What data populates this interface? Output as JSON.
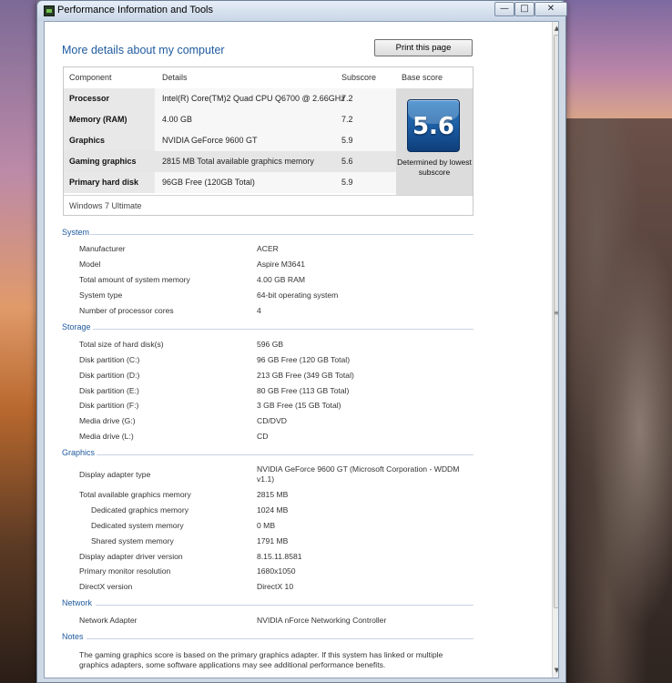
{
  "window": {
    "title": "Performance Information and Tools",
    "controls": {
      "minimize": "—",
      "maximize": "□",
      "close": "✕"
    }
  },
  "header": {
    "title": "More details about my computer",
    "print_button": "Print this page"
  },
  "score_table": {
    "columns": [
      "Component",
      "Details",
      "Subscore",
      "Base score"
    ],
    "rows": [
      {
        "component": "Processor",
        "details": "Intel(R) Core(TM)2 Quad CPU Q6700 @ 2.66GHz",
        "subscore": "7.2"
      },
      {
        "component": "Memory (RAM)",
        "details": "4.00 GB",
        "subscore": "7.2"
      },
      {
        "component": "Graphics",
        "details": "NVIDIA GeForce 9600 GT",
        "subscore": "5.9"
      },
      {
        "component": "Gaming graphics",
        "details": "2815 MB Total available graphics memory",
        "subscore": "5.6"
      },
      {
        "component": "Primary hard disk",
        "details": "96GB Free (120GB Total)",
        "subscore": "5.9"
      }
    ],
    "base_score": "5.6",
    "base_note": "Determined by lowest subscore",
    "edition": "Windows 7 Ultimate"
  },
  "system": {
    "title": "System",
    "items": [
      {
        "label": "Manufacturer",
        "value": "ACER"
      },
      {
        "label": "Model",
        "value": "Aspire M3641"
      },
      {
        "label": "Total amount of system memory",
        "value": "4.00 GB RAM"
      },
      {
        "label": "System type",
        "value": "64-bit operating system"
      },
      {
        "label": "Number of processor cores",
        "value": "4"
      }
    ]
  },
  "storage": {
    "title": "Storage",
    "items": [
      {
        "label": "Total size of hard disk(s)",
        "value": "596 GB"
      },
      {
        "label": "Disk partition (C:)",
        "value": "96 GB Free (120 GB Total)"
      },
      {
        "label": "Disk partition (D:)",
        "value": "213 GB Free (349 GB Total)"
      },
      {
        "label": "Disk partition (E:)",
        "value": "80 GB Free (113 GB Total)"
      },
      {
        "label": "Disk partition (F:)",
        "value": "3 GB Free (15 GB Total)"
      },
      {
        "label": "Media drive (G:)",
        "value": "CD/DVD"
      },
      {
        "label": "Media drive (L:)",
        "value": "CD"
      }
    ]
  },
  "graphics": {
    "title": "Graphics",
    "items": [
      {
        "label": "Display adapter type",
        "value": "NVIDIA GeForce 9600 GT (Microsoft Corporation - WDDM v1.1)"
      },
      {
        "label": "Total available graphics memory",
        "value": "2815 MB"
      },
      {
        "label": "Dedicated graphics memory",
        "value": "1024 MB"
      },
      {
        "label": "Dedicated system memory",
        "value": "0 MB"
      },
      {
        "label": "Shared system memory",
        "value": "1791 MB"
      },
      {
        "label": "Display adapter driver version",
        "value": "8.15.11.8581"
      },
      {
        "label": "Primary monitor resolution",
        "value": "1680x1050"
      },
      {
        "label": "DirectX version",
        "value": "DirectX 10"
      }
    ]
  },
  "network": {
    "title": "Network",
    "items": [
      {
        "label": "Network Adapter",
        "value": "NVIDIA nForce Networking Controller"
      }
    ]
  },
  "notes": {
    "title": "Notes",
    "text": "The gaming graphics score is based on the primary graphics adapter. If this system has linked or multiple graphics adapters, some software applications may see additional performance benefits."
  }
}
